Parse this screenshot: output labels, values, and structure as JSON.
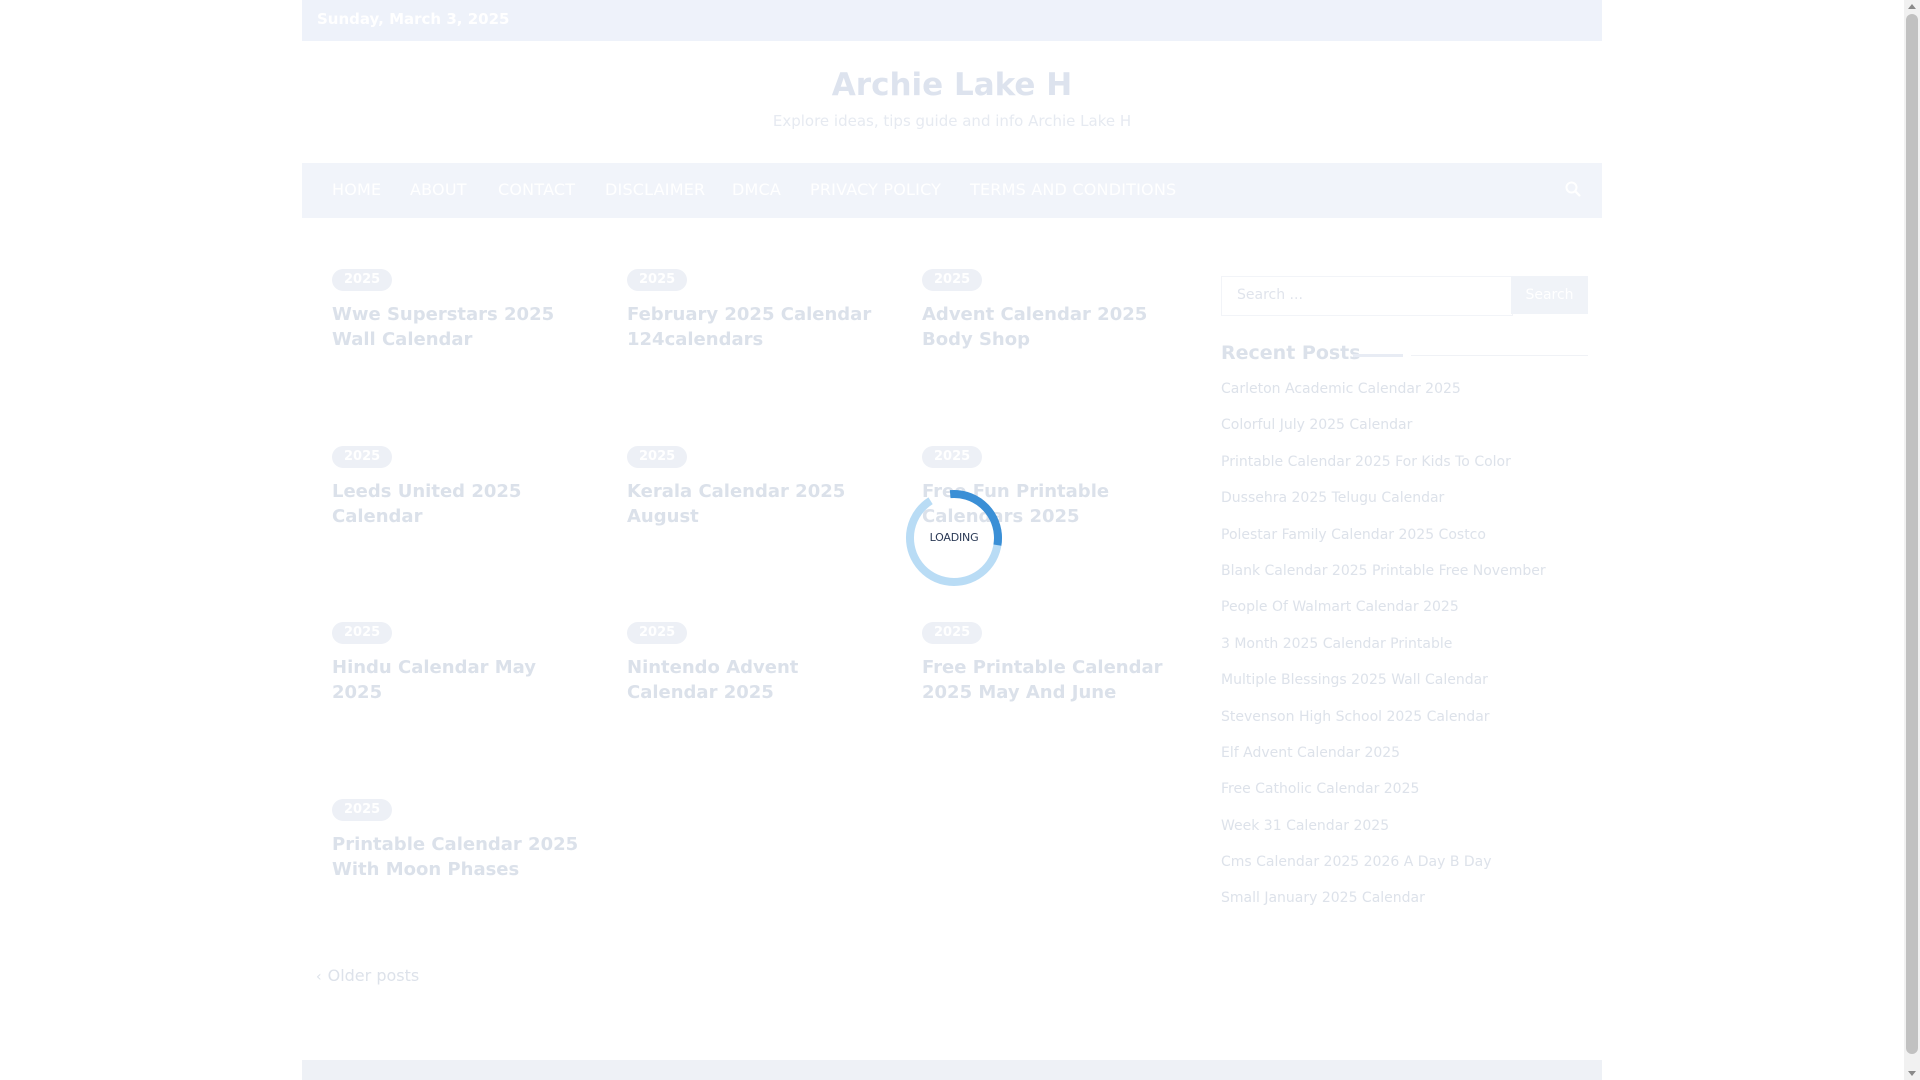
{
  "topbar": {
    "date": "Sunday, March 3, 2025"
  },
  "site": {
    "title": "Archie Lake H",
    "description": "Explore ideas, tips guide and info Archie Lake H"
  },
  "nav": {
    "items": [
      "HOME",
      "ABOUT",
      "CONTACT",
      "DISCLAIMER",
      "DMCA",
      "PRIVACY POLICY",
      "TERMS AND CONDITIONS"
    ],
    "search_icon": "search-icon"
  },
  "posts": [
    {
      "category": "2025",
      "title": "Wwe Superstars 2025 Wall Calendar"
    },
    {
      "category": "2025",
      "title": "February 2025 Calendar 124calendars"
    },
    {
      "category": "2025",
      "title": "Advent Calendar 2025 Body Shop"
    },
    {
      "category": "2025",
      "title": "Leeds United 2025 Calendar"
    },
    {
      "category": "2025",
      "title": "Kerala Calendar 2025 August"
    },
    {
      "category": "2025",
      "title": "Free Fun Printable Calendars 2025"
    },
    {
      "category": "2025",
      "title": "Hindu Calendar May 2025"
    },
    {
      "category": "2025",
      "title": "Nintendo Advent Calendar 2025"
    },
    {
      "category": "2025",
      "title": "Free Printable Calendar 2025 May And June"
    },
    {
      "category": "2025",
      "title": "Printable Calendar 2025 With Moon Phases"
    }
  ],
  "sidebar": {
    "search_placeholder": "Search ...",
    "search_button": "Search",
    "recent_heading": "Recent Posts",
    "recent_posts": [
      "Carleton Academic Calendar 2025",
      "Colorful July 2025 Calendar",
      "Printable Calendar 2025 For Kids To Color",
      "Dussehra 2025 Telugu Calendar",
      "Polestar Family Calendar 2025 Costco",
      "Blank Calendar 2025 Printable Free November",
      "People Of Walmart Calendar 2025",
      "3 Month 2025 Calendar Printable",
      "Multiple Blessings 2025 Wall Calendar",
      "Stevenson High School 2025 Calendar",
      "Elf Advent Calendar 2025",
      "Free Catholic Calendar 2025",
      "Week 31 Calendar 2025",
      "Cms Calendar 2025 2026 A Day B Day",
      "Small January 2025 Calendar"
    ]
  },
  "pagination": {
    "older_label": "Older posts"
  },
  "loader": {
    "text": "LOADING"
  },
  "colors": {
    "accent": "#3a8fd6",
    "accent_light": "#b9dcf5",
    "faded_text": "#dbe1ea"
  }
}
